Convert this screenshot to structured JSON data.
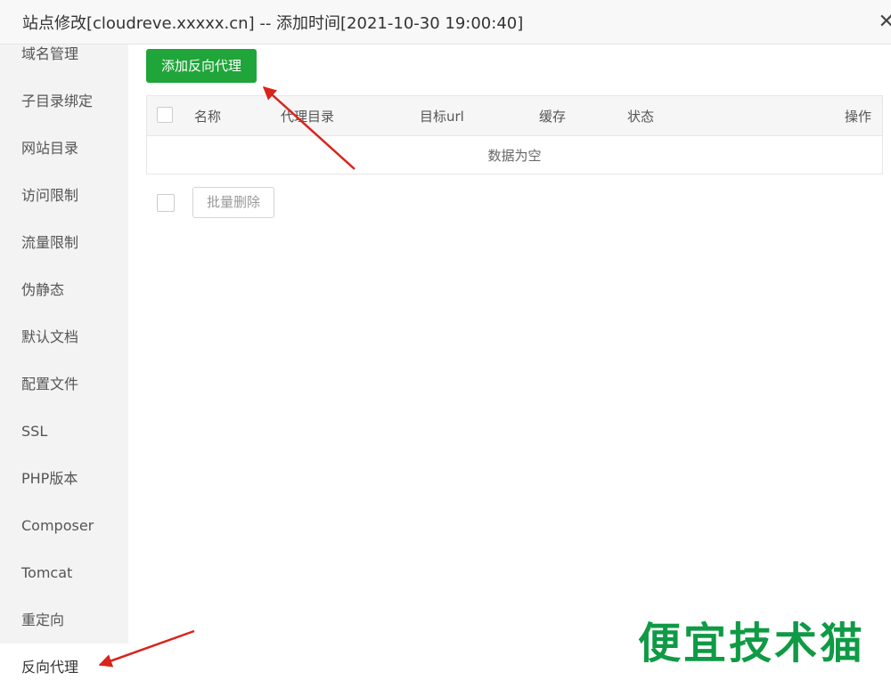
{
  "window": {
    "title": "站点修改[cloudreve.xxxxx.cn] -- 添加时间[2021-10-30 19:00:40]",
    "close_icon": "close-icon"
  },
  "sidebar": {
    "items": [
      {
        "label": "域名管理"
      },
      {
        "label": "子目录绑定"
      },
      {
        "label": "网站目录"
      },
      {
        "label": "访问限制"
      },
      {
        "label": "流量限制"
      },
      {
        "label": "伪静态"
      },
      {
        "label": "默认文档"
      },
      {
        "label": "配置文件"
      },
      {
        "label": "SSL"
      },
      {
        "label": "PHP版本"
      },
      {
        "label": "Composer"
      },
      {
        "label": "Tomcat"
      },
      {
        "label": "重定向"
      },
      {
        "label": "反向代理",
        "active": true
      }
    ]
  },
  "main": {
    "add_button": "添加反向代理",
    "table": {
      "columns": [
        "名称",
        "代理目录",
        "目标url",
        "缓存",
        "状态",
        "操作"
      ],
      "empty_text": "数据为空"
    },
    "batch_delete_button": "批量删除"
  },
  "watermark": "便宜技术猫",
  "colors": {
    "accent": "#20a53a",
    "annotation_arrow": "#d9241c",
    "watermark": "#0f9a45"
  }
}
